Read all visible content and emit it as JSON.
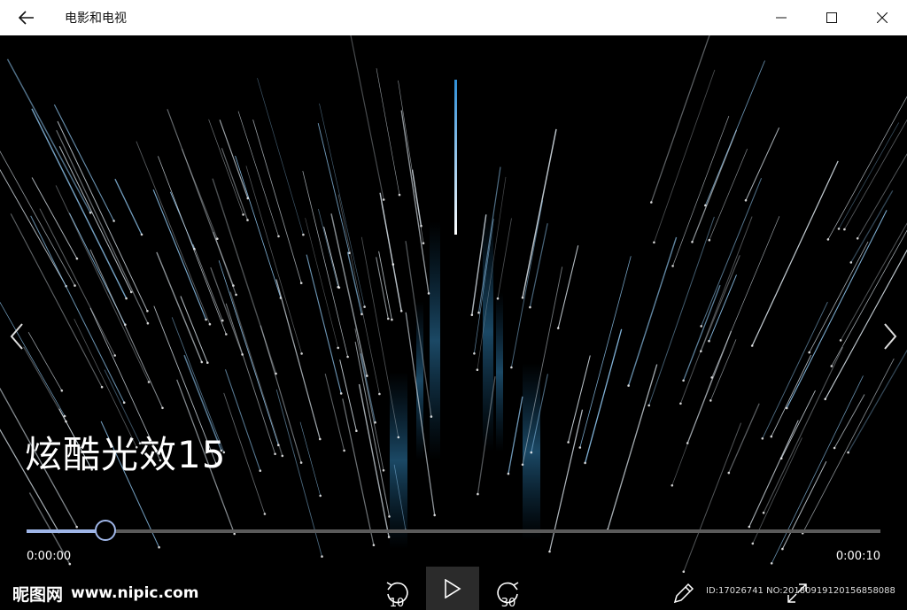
{
  "window": {
    "title": "电影和电视",
    "back_icon": "back-arrow-icon",
    "minimize_icon": "minimize-icon",
    "maximize_icon": "maximize-icon",
    "close_icon": "close-icon"
  },
  "player": {
    "media_title": "炫酷光效15",
    "current_time": "0:00:00",
    "duration": "0:00:10",
    "progress_fraction": 0.092,
    "skip_back_label": "10",
    "skip_forward_label": "30",
    "accent_color": "#9fb6e8"
  },
  "watermark": {
    "logo_text": "昵图网",
    "site_text": "www.nipic.com",
    "id_text": "ID:17026741 NO:20180919120156858088"
  }
}
